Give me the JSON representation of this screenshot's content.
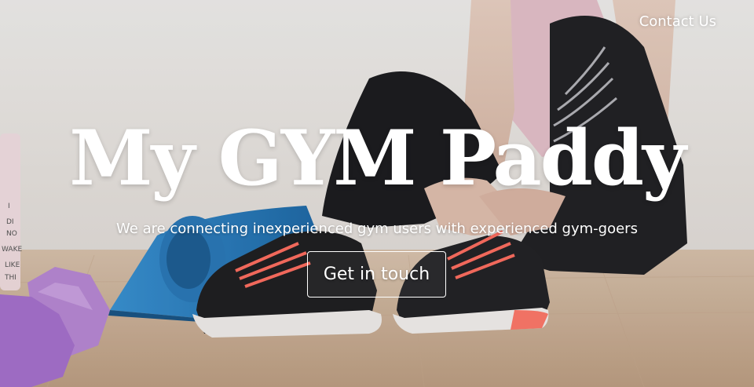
{
  "nav": {
    "contact_label": "Contact Us"
  },
  "hero": {
    "title": "My GYM Paddy",
    "subtitle": "We are connecting inexperienced gym users with experienced gym-goers",
    "cta_label": "Get in touch",
    "bottle_text": "I DI NO WAKE LIKE THI"
  },
  "colors": {
    "text": "#ffffff",
    "wall": "#ece8e4",
    "floor": "#cdb39a",
    "mat": "#2f7fbf",
    "dumbbell": "#b07ad0",
    "tank_top": "#e7c4cc",
    "leggings": "#1d1d20",
    "laces": "#ff6f61"
  }
}
